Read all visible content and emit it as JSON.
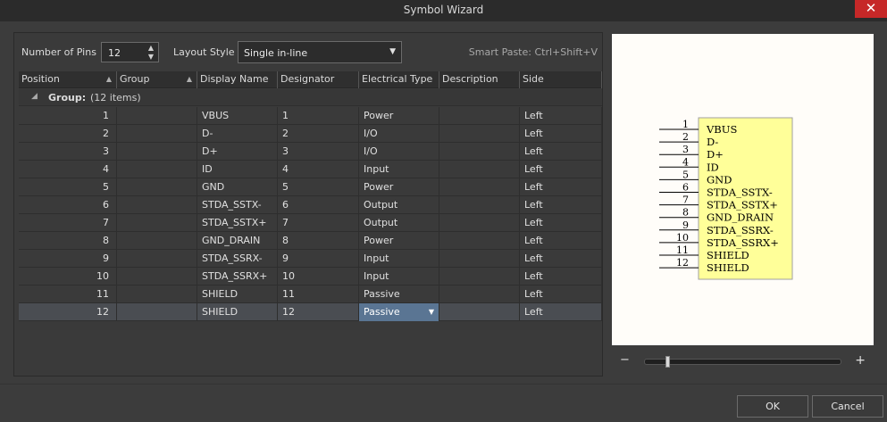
{
  "window": {
    "title": "Symbol Wizard",
    "close_glyph": "✕"
  },
  "toolbar": {
    "pins_label": "Number of Pins",
    "pins_value": "12",
    "layout_label": "Layout Style",
    "layout_value": "Single in-line",
    "smart_paste": "Smart Paste: Ctrl+Shift+V"
  },
  "grid": {
    "headers": [
      "Position",
      "Group",
      "Display Name",
      "Designator",
      "Electrical Type",
      "Description",
      "Side"
    ],
    "group_label": "Group:",
    "group_count": "(12 items)",
    "rows": [
      {
        "position": "1",
        "group": "",
        "name": "VBUS",
        "designator": "1",
        "type": "Power",
        "description": "",
        "side": "Left"
      },
      {
        "position": "2",
        "group": "",
        "name": "D-",
        "designator": "2",
        "type": "I/O",
        "description": "",
        "side": "Left"
      },
      {
        "position": "3",
        "group": "",
        "name": "D+",
        "designator": "3",
        "type": "I/O",
        "description": "",
        "side": "Left"
      },
      {
        "position": "4",
        "group": "",
        "name": "ID",
        "designator": "4",
        "type": "Input",
        "description": "",
        "side": "Left"
      },
      {
        "position": "5",
        "group": "",
        "name": "GND",
        "designator": "5",
        "type": "Power",
        "description": "",
        "side": "Left"
      },
      {
        "position": "6",
        "group": "",
        "name": "STDA_SSTX-",
        "designator": "6",
        "type": "Output",
        "description": "",
        "side": "Left"
      },
      {
        "position": "7",
        "group": "",
        "name": "STDA_SSTX+",
        "designator": "7",
        "type": "Output",
        "description": "",
        "side": "Left"
      },
      {
        "position": "8",
        "group": "",
        "name": "GND_DRAIN",
        "designator": "8",
        "type": "Power",
        "description": "",
        "side": "Left"
      },
      {
        "position": "9",
        "group": "",
        "name": "STDA_SSRX-",
        "designator": "9",
        "type": "Input",
        "description": "",
        "side": "Left"
      },
      {
        "position": "10",
        "group": "",
        "name": "STDA_SSRX+",
        "designator": "10",
        "type": "Input",
        "description": "",
        "side": "Left"
      },
      {
        "position": "11",
        "group": "",
        "name": "SHIELD",
        "designator": "11",
        "type": "Passive",
        "description": "",
        "side": "Left"
      },
      {
        "position": "12",
        "group": "",
        "name": "SHIELD",
        "designator": "12",
        "type": "Passive",
        "description": "",
        "side": "Left"
      }
    ]
  },
  "preview": {
    "body_fill": "#ffff99",
    "body_stroke": "#a0a0a0"
  },
  "buttons": {
    "ok": "OK",
    "cancel": "Cancel"
  },
  "zoom": {
    "minus": "−",
    "plus": "+"
  }
}
